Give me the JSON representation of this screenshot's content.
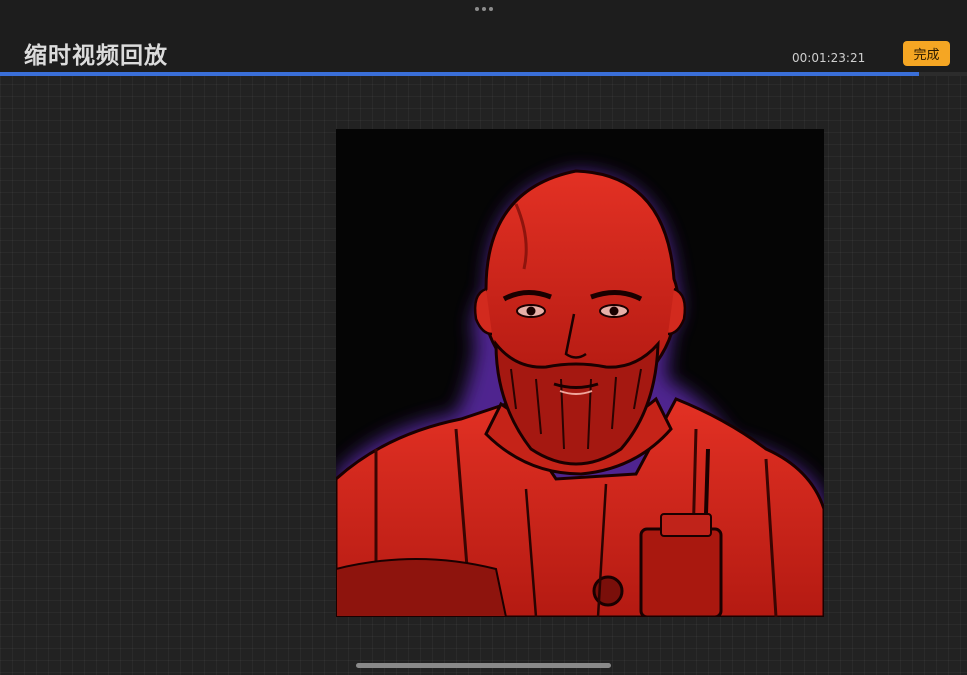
{
  "header": {
    "title": "缩时视频回放",
    "timecode": "00:01:23:21",
    "done_label": "完成"
  },
  "playback": {
    "progress": 0.95
  },
  "icons": {
    "grabber": "more-dots-icon"
  },
  "colors": {
    "accent": "#3a6fd8",
    "done_button": "#f5a623",
    "artwork_main": "#d8261c",
    "artwork_background": "#050505"
  }
}
